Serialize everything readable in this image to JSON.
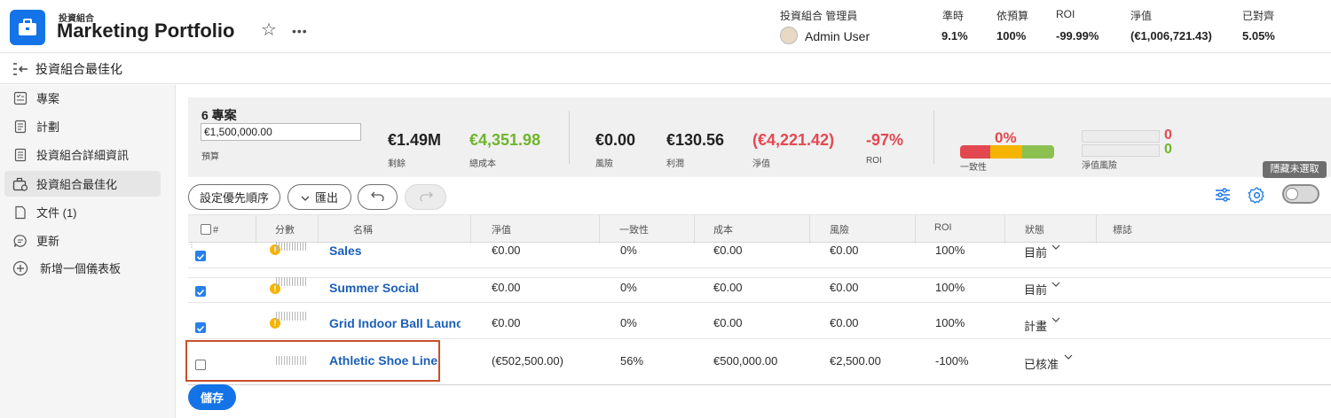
{
  "header": {
    "kicker": "投資組合",
    "title": "Marketing Portfolio",
    "owner_label": "投資組合 管理員",
    "owner_name": "Admin User",
    "metrics": [
      {
        "label": "準時",
        "value": "9.1%"
      },
      {
        "label": "依預算",
        "value": "100%"
      },
      {
        "label": "ROI",
        "value": "-99.99%"
      },
      {
        "label": "淨值",
        "value": "(€1,006,721.43)"
      },
      {
        "label": "已對齊",
        "value": "5.05%"
      }
    ]
  },
  "subheader": {
    "title": "投資組合最佳化"
  },
  "sidebar": {
    "items": [
      {
        "label": "專案",
        "icon": "projects-icon"
      },
      {
        "label": "計劃",
        "icon": "plans-icon"
      },
      {
        "label": "投資組合詳細資訊",
        "icon": "details-icon"
      },
      {
        "label": "投資組合最佳化",
        "icon": "optimizer-icon"
      },
      {
        "label": "文件 (1)",
        "icon": "document-icon"
      },
      {
        "label": "更新",
        "icon": "updates-icon"
      },
      {
        "label": "新增一個儀表板",
        "icon": "add-icon"
      }
    ]
  },
  "summary": {
    "project_count": "6 專案",
    "budget_value": "€1,500,000.00",
    "budget_label": "預算",
    "remaining_value": "€1.49M",
    "remaining_label": "剩餘",
    "total_cost_value": "€4,351.98",
    "total_cost_label": "總成本",
    "risk_value": "€0.00",
    "risk_label": "風險",
    "profit_value": "€130.56",
    "profit_label": "利潤",
    "net_value": "(€4,221.42)",
    "net_label": "淨值",
    "roi_value": "-97%",
    "roi_label": "ROI",
    "alignment_value": "0%",
    "alignment_label": "一致性",
    "net_risk_label": "淨值風險",
    "net_risk_top": "0",
    "net_risk_bottom": "0"
  },
  "toolbar": {
    "prioritize_label": "設定優先順序",
    "export_label": "匯出",
    "hide_unselected_tooltip": "隱藏未選取"
  },
  "table": {
    "columns": {
      "num": "#",
      "score": "分數",
      "name": "名稱",
      "net_value": "淨值",
      "alignment": "一致性",
      "cost": "成本",
      "risk": "風險",
      "roi": "ROI",
      "status": "狀態",
      "flag": "標誌"
    },
    "rows": [
      {
        "checked": true,
        "warning": true,
        "name": "Sales",
        "net_value": "€0.00",
        "alignment": "0%",
        "cost": "€0.00",
        "risk": "€0.00",
        "roi": "100%",
        "status": "目前"
      },
      {
        "checked": true,
        "warning": true,
        "name": "Summer Social",
        "net_value": "€0.00",
        "alignment": "0%",
        "cost": "€0.00",
        "risk": "€0.00",
        "roi": "100%",
        "status": "目前"
      },
      {
        "checked": true,
        "warning": true,
        "name": "Grid Indoor Ball Launch",
        "net_value": "€0.00",
        "alignment": "0%",
        "cost": "€0.00",
        "risk": "€0.00",
        "roi": "100%",
        "status": "計畫"
      },
      {
        "checked": false,
        "warning": false,
        "name": "Athletic Shoe Line",
        "net_value": "(€502,500.00)",
        "alignment": "56%",
        "cost": "€500,000.00",
        "risk": "€2,500.00",
        "roi": "-100%",
        "status": "已核准"
      }
    ]
  },
  "footer": {
    "save_label": "儲存"
  },
  "colors": {
    "accent": "#1473e6",
    "positive": "#6fb52c",
    "negative": "#e34850",
    "warning": "#f5b400",
    "highlight": "#c8502a"
  }
}
